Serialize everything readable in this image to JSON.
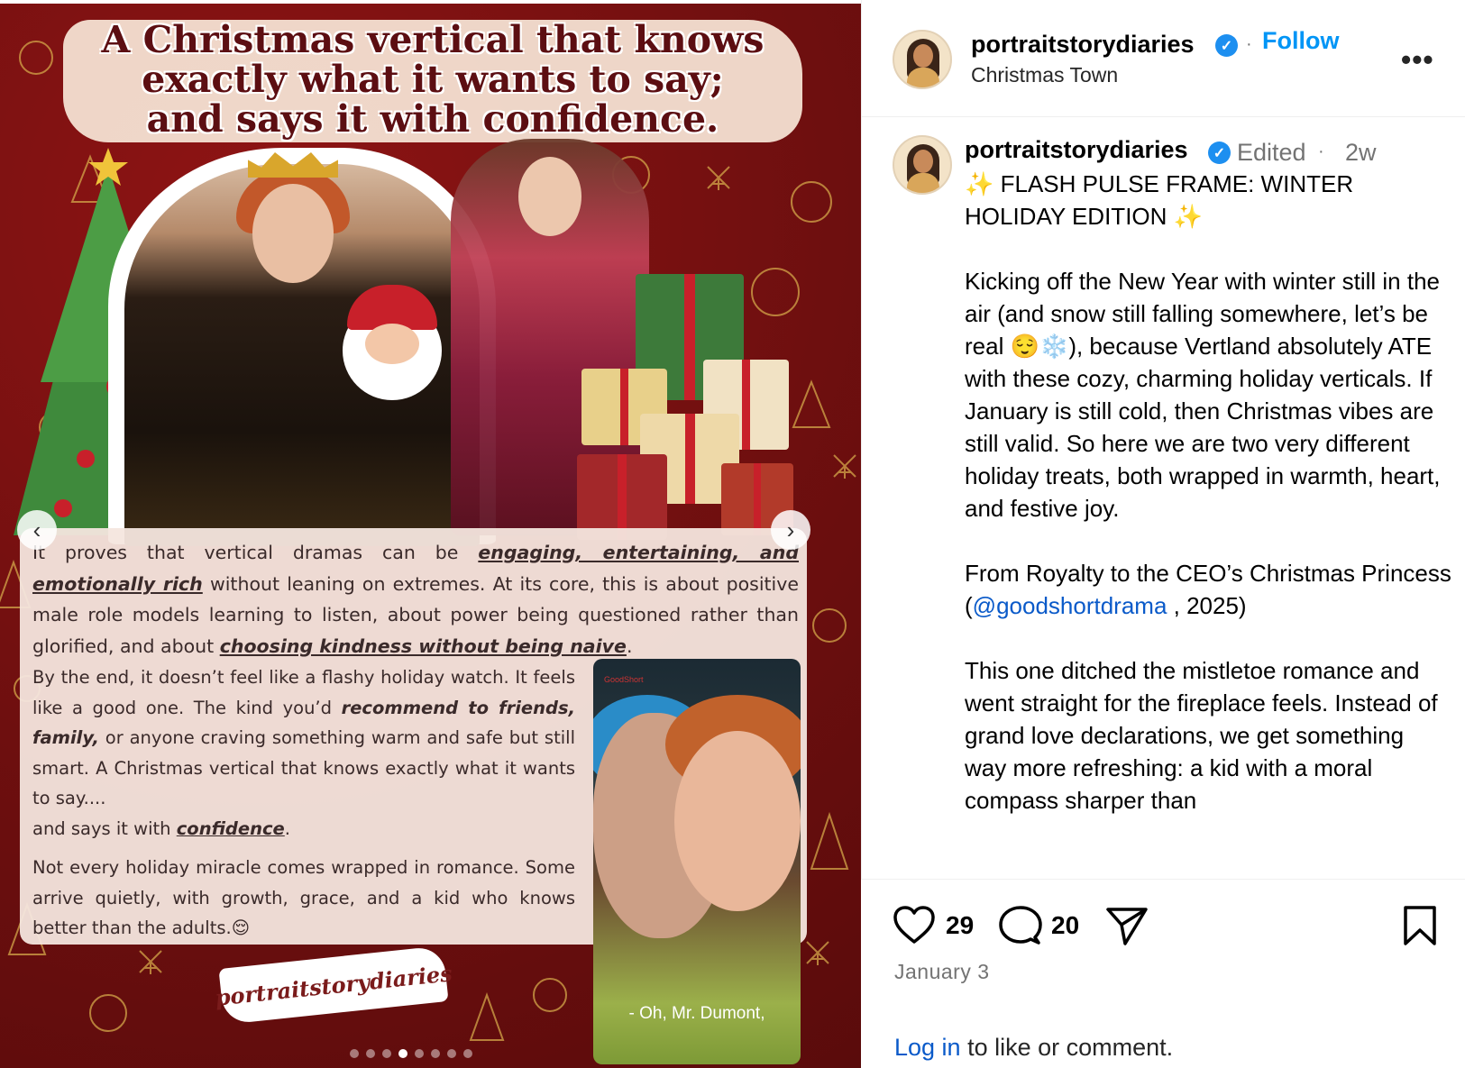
{
  "media": {
    "title_line1": "A Christmas vertical that knows",
    "title_line2": "exactly what it wants to say;",
    "title_line3": "and says it with confidence.",
    "p1_a": "It proves that vertical dramas can be ",
    "p1_b": "engaging, entertaining, and emotionally rich",
    "p1_c": " without leaning on extremes. At its core, this is about positive male role models learning to listen, about power being questioned rather than glorified, and about ",
    "p1_d": "choosing kindness without being naive",
    "p1_e": ".",
    "p2_a": "By the end, it doesn’t feel like a flashy holiday watch. It feels like a good one. The kind you’d ",
    "p2_b": "recommend to friends, family,",
    "p2_c": " or anyone craving something warm and safe but still smart. A Christmas vertical that knows exactly what it wants to say....",
    "p2_d": "and says it with ",
    "p2_e": "confidence",
    "p2_f": ".",
    "p3": "Not every holiday miracle comes wrapped in romance. Some arrive quietly, with growth, grace, and a kid who knows better than the adults.😌",
    "poster_logo": "GoodShort",
    "poster_caption": "- Oh, Mr. Dumont,",
    "watermark": "portraitstorydiaries",
    "prev_icon": "‹",
    "next_icon": "›",
    "dots": 8,
    "active_dot": 3
  },
  "header": {
    "username": "portraitstorydiaries",
    "verified_icon": "✓",
    "follow_label": "Follow",
    "location": "Christmas Town",
    "more_icon": "•••"
  },
  "caption": {
    "username": "portraitstorydiaries",
    "edited": "Edited",
    "age": "2w",
    "text_1": "✨ FLASH PULSE FRAME: WINTER HOLIDAY EDITION ✨\n\nKicking off the New Year with winter still in the air (and snow still falling somewhere, let’s be real 😌❄️), because Vertland absolutely ATE with these cozy, charming holiday verticals. If January is still cold, then Christmas vibes are still valid. So here we are two very different holiday treats, both wrapped in warmth, heart, and festive joy.\n\nFrom Royalty to the CEO’s Christmas Princess\n(",
    "mention": "@goodshortdrama",
    "text_2": " , 2025)\n\nThis one ditched the mistletoe romance and went straight for the fireplace feels. Instead of grand love declarations, we get something way more refreshing: a kid with a moral compass sharper than"
  },
  "actions": {
    "likes": "29",
    "comments": "20",
    "date": "January 3",
    "login_link": "Log in",
    "login_rest": " to like or comment."
  }
}
